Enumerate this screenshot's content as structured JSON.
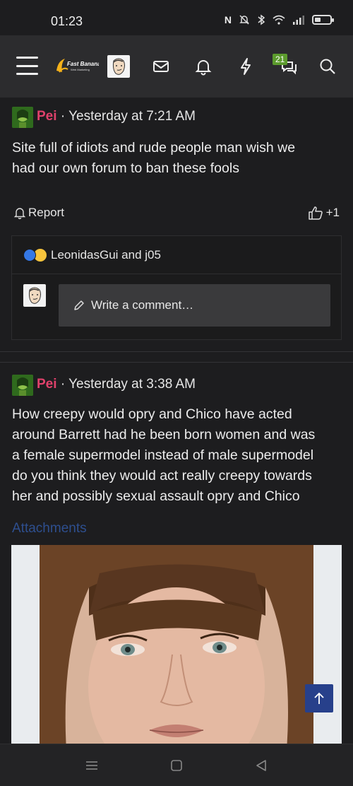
{
  "status_bar": {
    "time": "01:23",
    "nfc": "N",
    "signal_badge": "",
    "battery_label": ""
  },
  "header": {
    "logo_text": "Fast Banana",
    "logo_sub": "Web Marketing",
    "notification_badge": "21"
  },
  "posts": [
    {
      "username": "Pei",
      "separator": "·",
      "timestamp": "Yesterday at 7:21 AM",
      "lines": [
        "Site full of idiots and rude people man wish we",
        "had our own forum to ban these fools"
      ],
      "report_label": "Report",
      "like_label": "+1",
      "reaction_names": "LeonidasGui and j05",
      "comment_placeholder": "Write a comment…"
    },
    {
      "username": "Pei",
      "separator": "·",
      "timestamp": "Yesterday at 3:38 AM",
      "lines": [
        "How creepy would opry and Chico have acted",
        "around Barrett had he been born women and was",
        "a female supermodel instead of male supermodel",
        "do you think they would act really creepy towards",
        "her and possibly sexual assault opry and Chico"
      ],
      "attachments_label": "Attachments"
    }
  ],
  "colors": {
    "username": "#e0416b",
    "badge": "#5c9b2d",
    "attachments_link": "#2e4f8f",
    "scroll_button": "#27408b"
  }
}
